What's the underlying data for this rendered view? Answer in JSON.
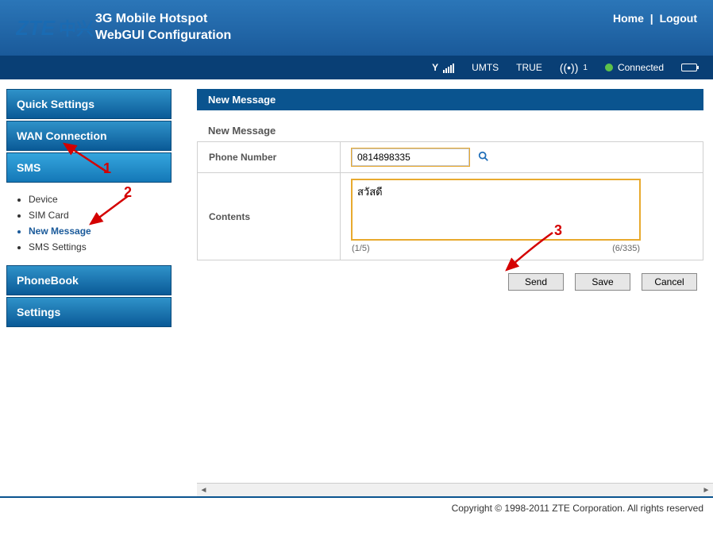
{
  "header": {
    "logo": "ZTE中兴",
    "title_line1": "3G Mobile Hotspot",
    "title_line2": "WebGUI Configuration",
    "links": {
      "home": "Home",
      "logout": "Logout"
    }
  },
  "status": {
    "network_type": "UMTS",
    "operator": "TRUE",
    "wifi_clients": "1",
    "connection": "Connected"
  },
  "sidebar": {
    "items": [
      {
        "label": "Quick Settings"
      },
      {
        "label": "WAN Connection"
      },
      {
        "label": "SMS",
        "expanded": true,
        "children": [
          {
            "label": "Device"
          },
          {
            "label": "SIM Card"
          },
          {
            "label": "New Message",
            "current": true
          },
          {
            "label": "SMS Settings"
          }
        ]
      },
      {
        "label": "PhoneBook"
      },
      {
        "label": "Settings"
      }
    ]
  },
  "panel": {
    "title": "New Message",
    "section": "New Message",
    "phone_label": "Phone Number",
    "phone_value": "0814898335",
    "contents_label": "Contents",
    "contents_value": "สวัสดี",
    "page_counter": "(1/5)",
    "char_counter": "(6/335)",
    "buttons": {
      "send": "Send",
      "save": "Save",
      "cancel": "Cancel"
    }
  },
  "annotations": {
    "n1": "1",
    "n2": "2",
    "n3": "3"
  },
  "footer": "Copyright © 1998-2011 ZTE Corporation. All rights reserved"
}
